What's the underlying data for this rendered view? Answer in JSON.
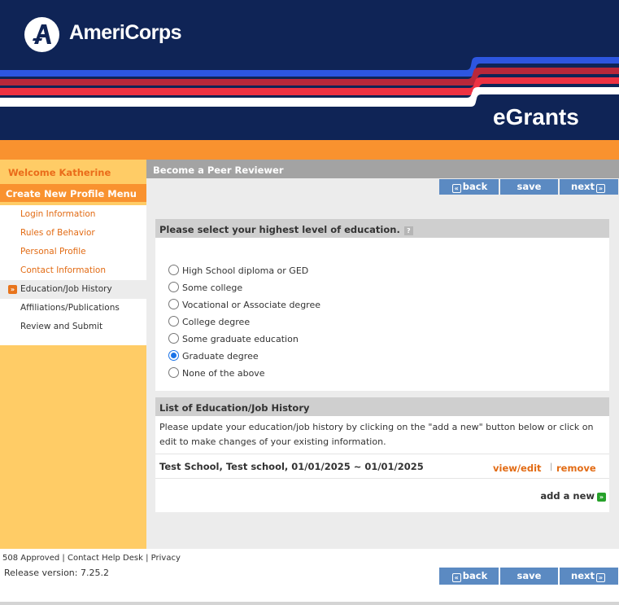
{
  "header": {
    "logo_text": "AmeriCorps",
    "app_name": "eGrants"
  },
  "sidebar": {
    "welcome": "Welcome Katherine",
    "menu_title": "Create New Profile Menu",
    "items": [
      {
        "label": "Login Information",
        "active": false
      },
      {
        "label": "Rules of Behavior",
        "active": false
      },
      {
        "label": "Personal Profile",
        "active": false
      },
      {
        "label": "Contact Information",
        "active": false
      },
      {
        "label": "Education/Job History",
        "active": true
      },
      {
        "label": "Affiliations/Publications",
        "active": false
      },
      {
        "label": "Review and Submit",
        "active": false
      }
    ]
  },
  "page": {
    "title": "Become a Peer Reviewer"
  },
  "nav_buttons": {
    "back": "back",
    "save": "save",
    "next": "next"
  },
  "education": {
    "heading": "Please select your highest level of education.",
    "help": "?",
    "options": [
      {
        "label": "High School diploma or GED",
        "checked": false
      },
      {
        "label": "Some college",
        "checked": false
      },
      {
        "label": "Vocational or Associate degree",
        "checked": false
      },
      {
        "label": "College degree",
        "checked": false
      },
      {
        "label": "Some graduate education",
        "checked": false
      },
      {
        "label": "Graduate degree",
        "checked": true
      },
      {
        "label": "None of the above",
        "checked": false
      }
    ]
  },
  "history": {
    "heading": "List of Education/Job History",
    "description": "Please update your education/job history by clicking on the \"add a new\" button below or click on edit to make changes of your existing information.",
    "entries": [
      {
        "text": "Test School, Test school, 01/01/2025 ~ 01/01/2025",
        "view_edit": "view/edit",
        "separator": "|",
        "remove": "remove"
      }
    ],
    "add_new": "add a new"
  },
  "footer": {
    "links": [
      "508 Approved",
      "Contact Help Desk",
      "Privacy"
    ],
    "release": "Release version: 7.25.2"
  },
  "colors": {
    "navy": "#0f2456",
    "orange": "#f9922f",
    "sidebar_yellow": "#ffcc66",
    "button_blue": "#5b8ac2",
    "link_orange": "#e26b14"
  }
}
